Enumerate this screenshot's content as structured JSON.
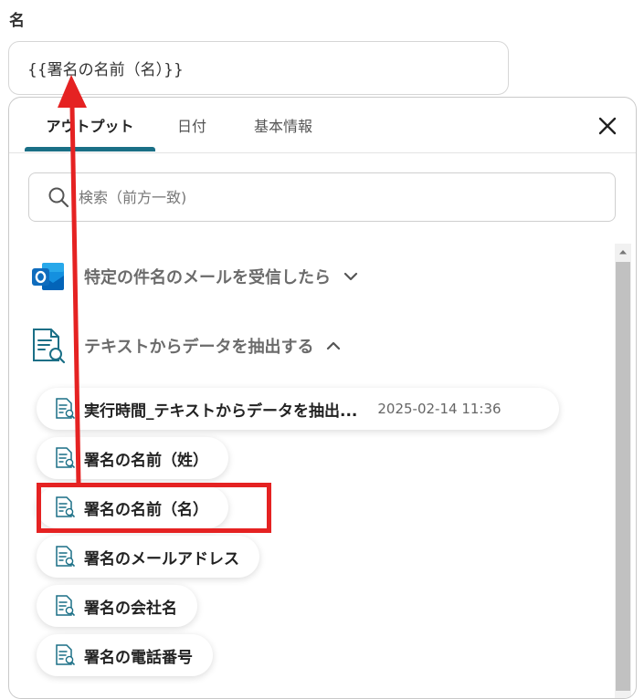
{
  "field": {
    "label": "名",
    "value": "{{署名の名前（名）}}"
  },
  "tabs": [
    {
      "label": "アウトプット",
      "active": true
    },
    {
      "label": "日付",
      "active": false
    },
    {
      "label": "基本情報",
      "active": false
    }
  ],
  "search": {
    "placeholder": "検索（前方一致)"
  },
  "sections": [
    {
      "label": "特定の件名のメールを受信したら",
      "icon": "outlook-icon",
      "expanded": false
    },
    {
      "label": "テキストからデータを抽出する",
      "icon": "document-search-icon",
      "expanded": true
    }
  ],
  "items": [
    {
      "label": "実行時間_テキストからデータを抽出...",
      "value": "2025-02-14 11:36"
    },
    {
      "label": "署名の名前（姓）"
    },
    {
      "label": "署名の名前（名）",
      "highlighted": true
    },
    {
      "label": "署名のメールアドレス"
    },
    {
      "label": "署名の会社名"
    },
    {
      "label": "署名の電話番号"
    }
  ],
  "colors": {
    "accent": "#1a6f86",
    "annotation": "#e52222",
    "outlook_blue": "#0f6cbd"
  }
}
